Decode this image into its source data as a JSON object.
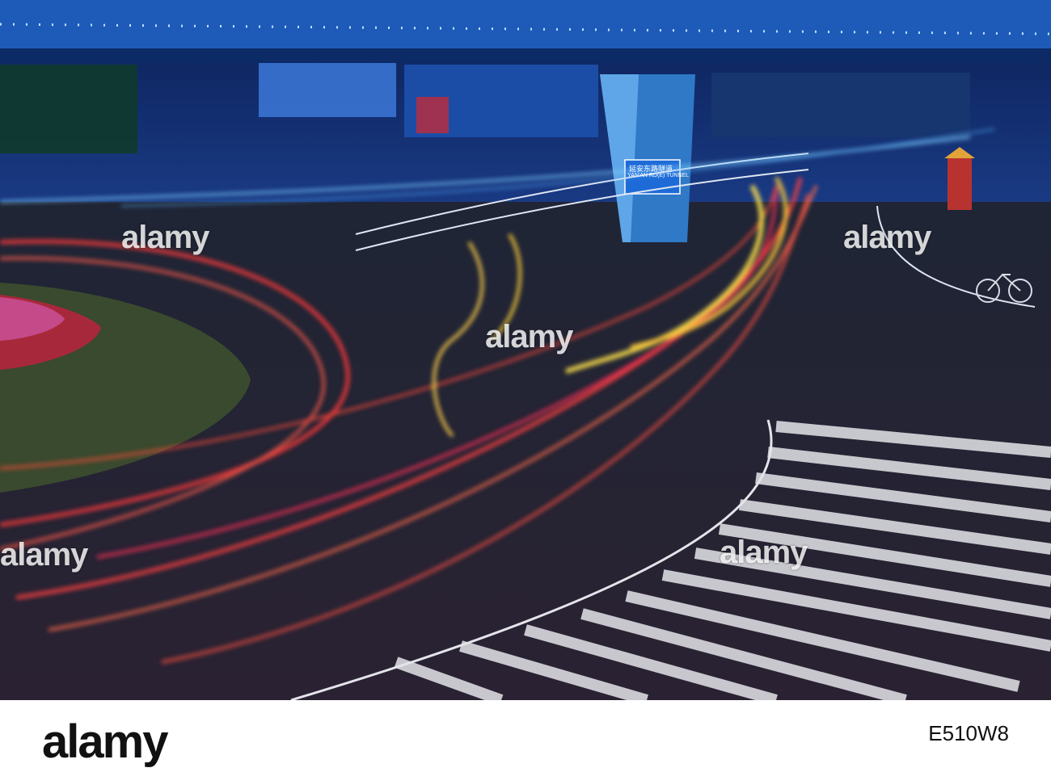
{
  "photo": {
    "watermark": "alamy"
  },
  "sign": {
    "line1": "延安东路隧道",
    "line2": "YAN'AN RD(E) TUNNEL"
  },
  "footer": {
    "logo": "alamy",
    "image_id": "E510W8"
  },
  "colors": {
    "overpass": "#1e5bb8",
    "trail_red": "#ff3b3b",
    "trail_yellow": "#ffd23a",
    "road": "#25222f",
    "footer_bg": "#ffffff"
  }
}
